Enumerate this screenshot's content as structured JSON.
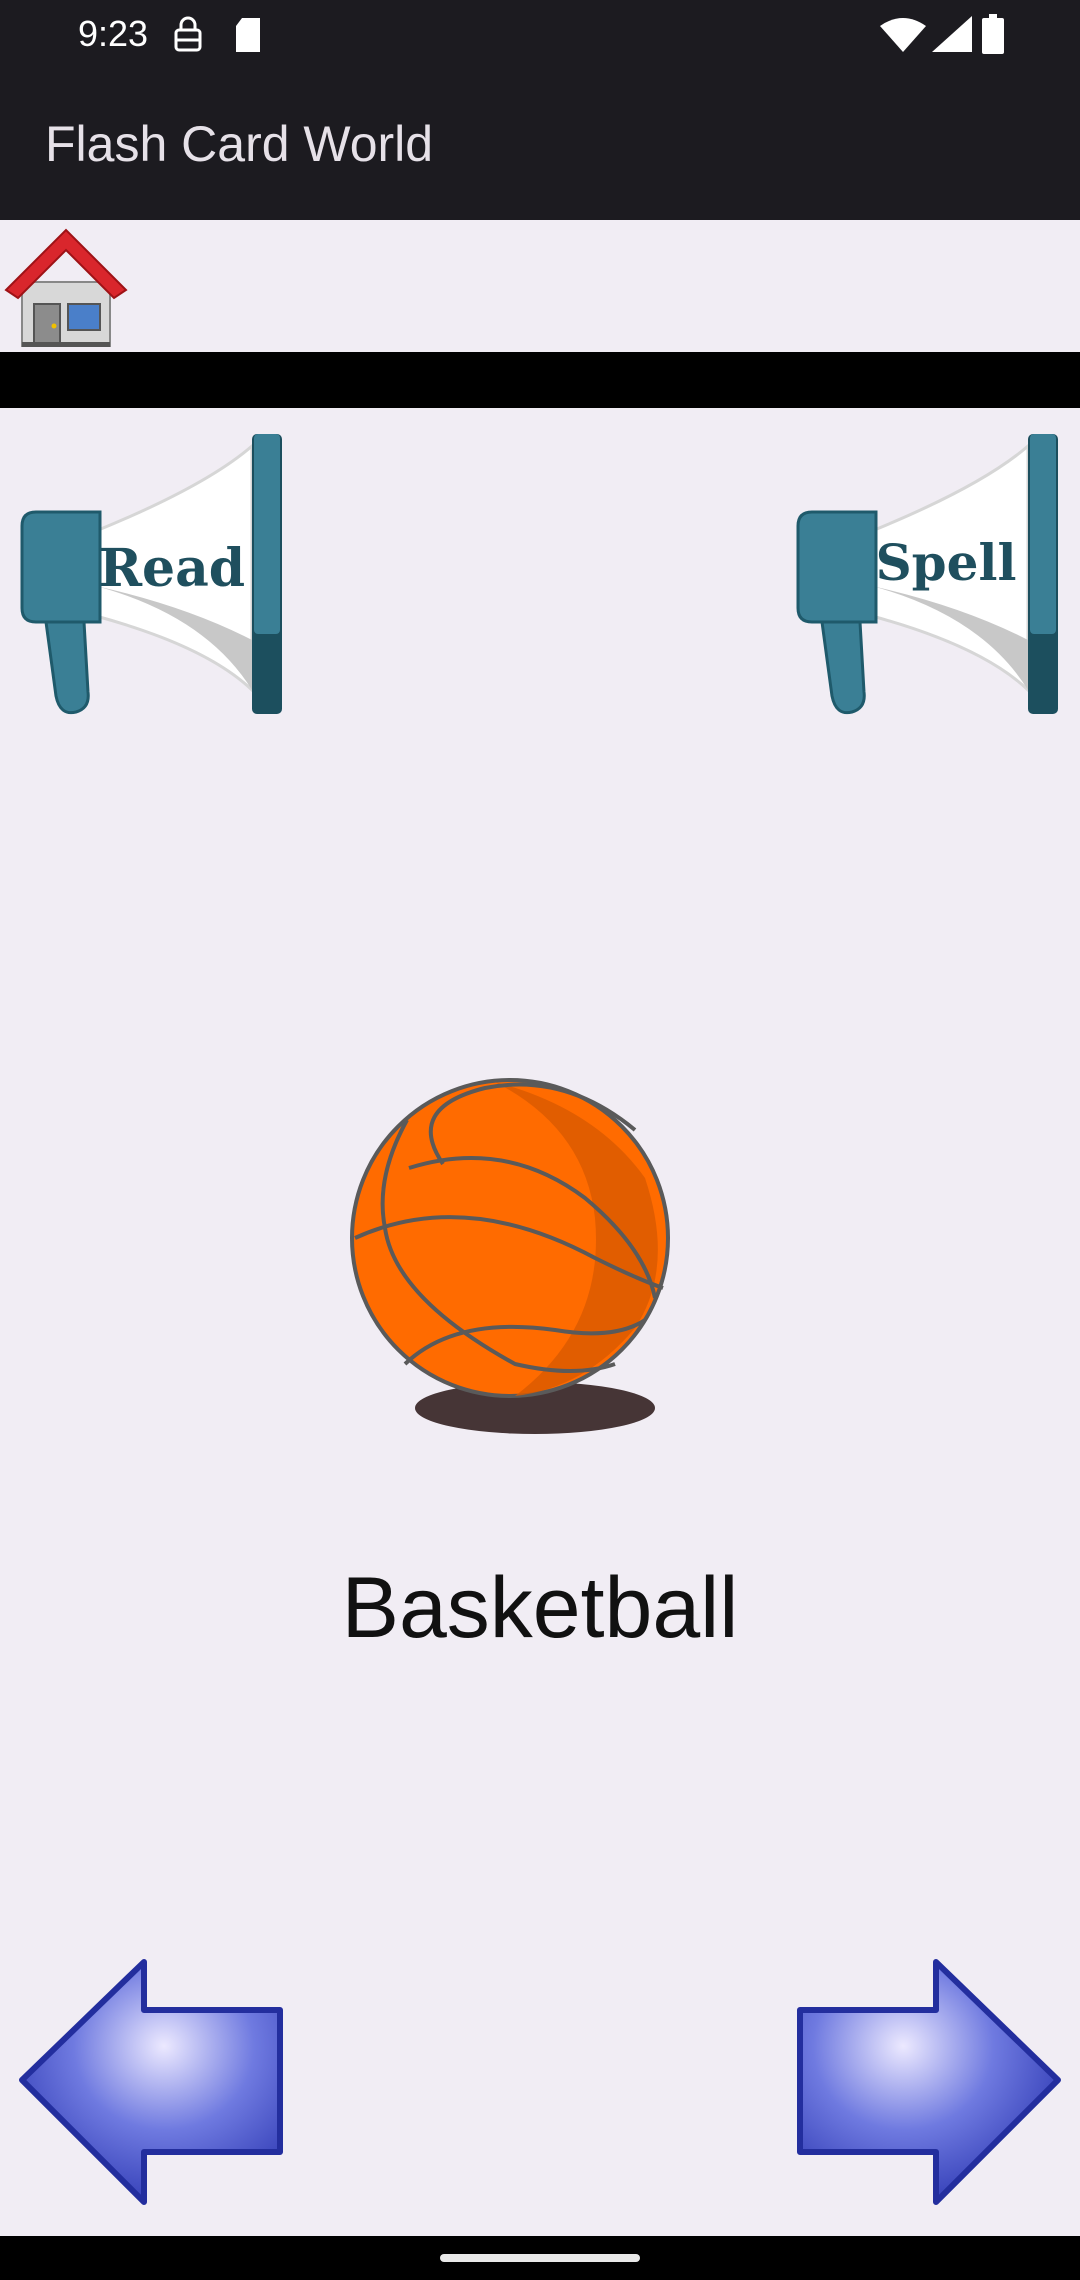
{
  "status_bar": {
    "time": "9:23",
    "left_icons": [
      "sim-lock-icon",
      "sd-card-icon"
    ],
    "right_icons": [
      "wifi-icon",
      "signal-icon",
      "battery-icon"
    ]
  },
  "app_bar": {
    "title": "Flash Card World"
  },
  "toolbar": {
    "home_icon": "house-icon"
  },
  "buttons": {
    "read_label": "Read",
    "spell_label": "Spell",
    "prev_icon": "arrow-left-icon",
    "next_icon": "arrow-right-icon"
  },
  "card": {
    "image_icon": "basketball-icon",
    "word": "Basketball"
  },
  "colors": {
    "app_bar": "#1c1b20",
    "background": "#f1edf4",
    "megaphone": "#3a7f95",
    "ball": "#ff6b00",
    "arrow": "#3b49c9",
    "roof": "#d9262c"
  }
}
